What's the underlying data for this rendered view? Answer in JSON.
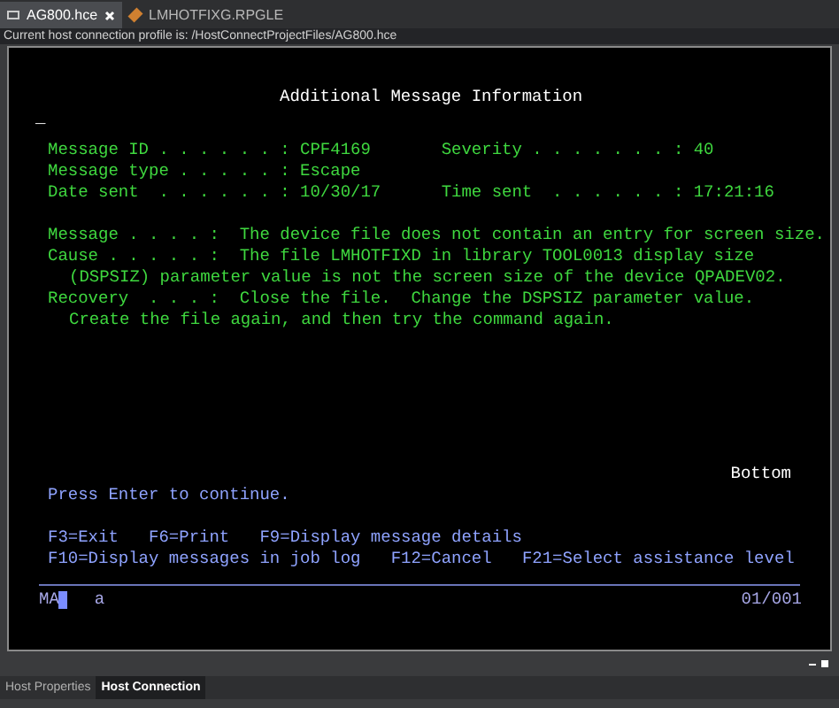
{
  "tabs": [
    {
      "label": "AG800.hce",
      "selected": true,
      "closable": true
    },
    {
      "label": "LMHOTFIXG.RPGLE",
      "selected": false,
      "closable": false
    }
  ],
  "profile_line": "Current host connection profile is: /HostConnectProjectFiles/AG800.hce",
  "screen": {
    "title": "Additional Message Information",
    "cursor_mark": "_",
    "fields": [
      {
        "label": "Message ID . . . . . . :",
        "value": "CPF4169",
        "label2": "Severity . . . . . . . :",
        "value2": "40"
      },
      {
        "label": "Message type . . . . . :",
        "value": "Escape"
      },
      {
        "label": "Date sent  . . . . . . :",
        "value": "10/30/17",
        "label2": "Time sent  . . . . . . :",
        "value2": "17:21:16"
      }
    ],
    "details": [
      {
        "label": "Message . . . . :",
        "text": "The device file does not contain an entry for screen size."
      },
      {
        "label": "Cause . . . . . :",
        "text": "The file LMHOTFIXD in library TOOL0013 display size",
        "continuation": "(DSPSIZ) parameter value is not the screen size of the device QPADEV02."
      },
      {
        "label": "Recovery  . . . :",
        "text": "Close the file.  Change the DSPSIZ parameter value.",
        "continuation": "Create the file again, and then try the command again."
      }
    ],
    "bottom_marker": "Bottom",
    "prompt": "Press Enter to continue.",
    "function_keys": [
      [
        "F3=Exit",
        "F6=Print",
        "F9=Display message details"
      ],
      [
        "F10=Display messages in job log",
        "F12=Cancel",
        "F21=Select assistance level"
      ]
    ]
  },
  "status_bar": {
    "indicator": "MA",
    "field": "a",
    "position": "01/001"
  },
  "bottom_tabs": [
    {
      "label": "Host Properties",
      "selected": false
    },
    {
      "label": "Host Connection",
      "selected": true
    }
  ]
}
